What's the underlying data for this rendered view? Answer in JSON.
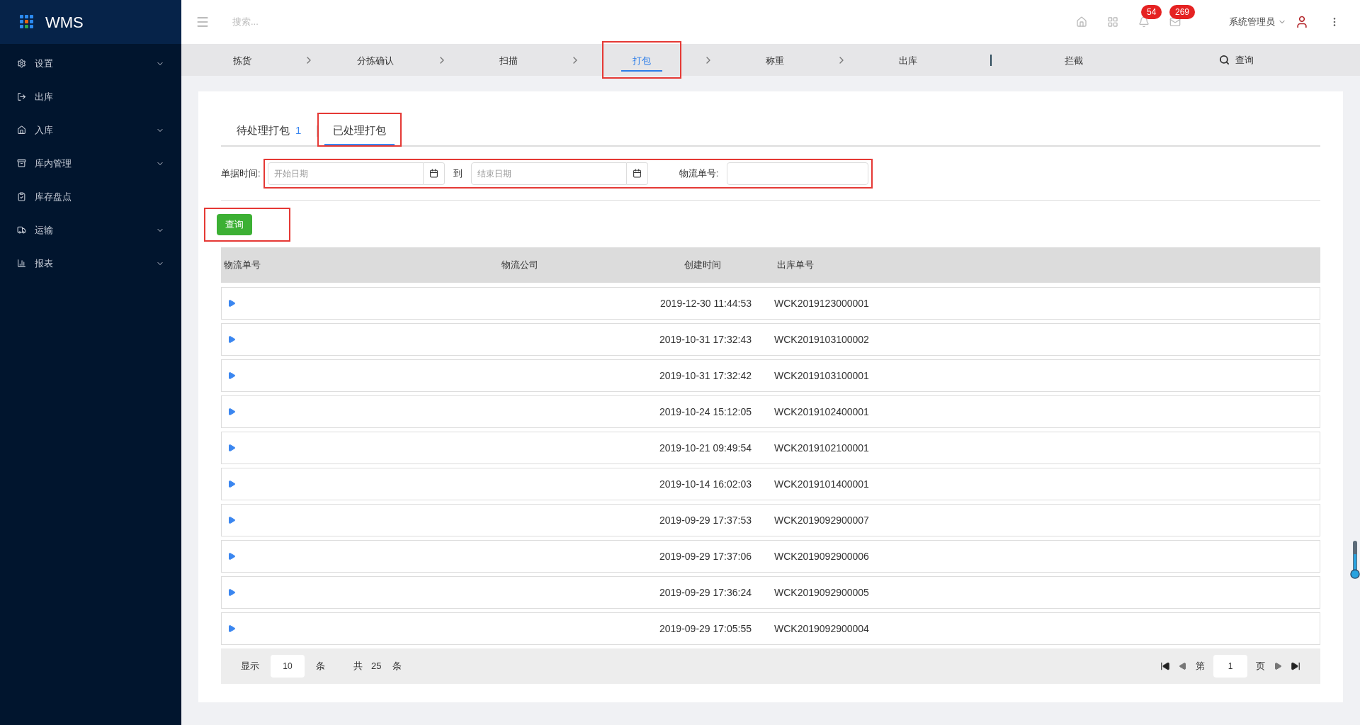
{
  "app": {
    "title": "WMS"
  },
  "sidebar": {
    "items": [
      {
        "label": "设置",
        "expandable": true
      },
      {
        "label": "出库",
        "expandable": false
      },
      {
        "label": "入库",
        "expandable": true
      },
      {
        "label": "库内管理",
        "expandable": true
      },
      {
        "label": "库存盘点",
        "expandable": false
      },
      {
        "label": "运输",
        "expandable": true
      },
      {
        "label": "报表",
        "expandable": true
      }
    ]
  },
  "header": {
    "search": {
      "placeholder": "搜索..."
    },
    "notifications": "54",
    "messages": "269",
    "user": "系统管理员"
  },
  "steps": {
    "items": [
      {
        "label": "拣货",
        "selected": false,
        "highlighted": false
      },
      {
        "label": "分拣确认",
        "selected": false,
        "highlighted": false
      },
      {
        "label": "扫描",
        "selected": false,
        "highlighted": false
      },
      {
        "label": "打包",
        "selected": true,
        "highlighted": true
      },
      {
        "label": "称重",
        "selected": false,
        "highlighted": false
      },
      {
        "label": "出库",
        "selected": false,
        "highlighted": false
      },
      {
        "label": "拦截",
        "selected": false,
        "highlighted": false
      }
    ],
    "query": "查询"
  },
  "tabs": [
    {
      "label": "待处理打包",
      "count": "1",
      "selected": false,
      "highlighted": false
    },
    {
      "label": "已处理打包",
      "selected": true,
      "highlighted": true
    }
  ],
  "filters": {
    "highlighted": true,
    "date_label": "单据时间:",
    "start": {
      "placeholder": "开始日期"
    },
    "to": "到",
    "end": {
      "placeholder": "结束日期"
    },
    "tracking_label": "物流单号:"
  },
  "query_button": {
    "label": "查询",
    "highlighted": true
  },
  "table": {
    "columns": [
      "物流单号",
      "物流公司",
      "创建时间",
      "出库单号"
    ],
    "rows": [
      {
        "created": "2019-12-30 11:44:53",
        "order": "WCK2019123000001",
        "expanded": false
      },
      {
        "created": "2019-10-31 17:32:43",
        "order": "WCK2019103100002",
        "expanded": false
      },
      {
        "created": "2019-10-31 17:32:42",
        "order": "WCK2019103100001",
        "expanded": false
      },
      {
        "created": "2019-10-24 15:12:05",
        "order": "WCK2019102400001",
        "expanded": false
      },
      {
        "created": "2019-10-21 09:49:54",
        "order": "WCK2019102100001",
        "expanded": false
      },
      {
        "created": "2019-10-14 16:02:03",
        "order": "WCK2019101400001",
        "expanded": false
      },
      {
        "created": "2019-09-29 17:37:53",
        "order": "WCK2019092900007",
        "expanded": false
      },
      {
        "created": "2019-09-29 17:37:06",
        "order": "WCK2019092900006",
        "expanded": false
      },
      {
        "created": "2019-09-29 17:36:24",
        "order": "WCK2019092900005",
        "expanded": false
      },
      {
        "created": "2019-09-29 17:05:55",
        "order": "WCK2019092900004",
        "expanded": false
      }
    ]
  },
  "pagination": {
    "show": "显示",
    "page_size": "10",
    "unit": "条",
    "total_label": "共",
    "total": "25",
    "total_unit": "条",
    "page_label": "第",
    "page": "1",
    "page_unit": "页"
  }
}
